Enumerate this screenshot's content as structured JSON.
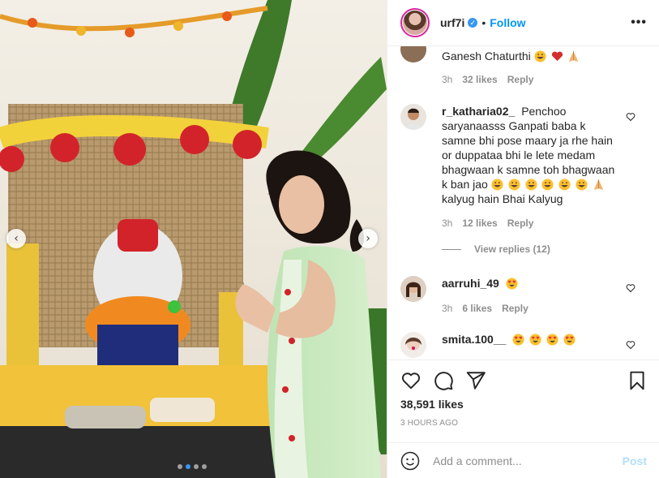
{
  "post": {
    "username": "urf7i",
    "verified_mark": "✓",
    "separator": "•",
    "follow_label": "Follow",
    "more_label": "•••",
    "likes_total": "38,591 likes",
    "timestamp": "3 HOURS AGO",
    "carousel": {
      "dot_count": 4,
      "active_index": 1,
      "prev_glyph": "‹",
      "next_glyph": "›"
    }
  },
  "comments": [
    {
      "username": "",
      "text": "Ganesh Chaturthi",
      "emojis": [
        "grin-emoji",
        "heart-emoji",
        "pray-emoji"
      ],
      "time": "3h",
      "likes": "32 likes",
      "reply": "Reply",
      "partial": true
    },
    {
      "username": "r_katharia02_",
      "text": "Penchoo saryanaasss Ganpati baba k samne bhi pose maary ja rhe hain or duppataa bhi le lete medam bhagwaan k samne toh bhagwaan k ban jao",
      "emojis": [
        "grin-emoji",
        "grin-emoji",
        "grin-emoji",
        "grin-emoji",
        "grin-emoji",
        "grin-emoji",
        "pray-emoji"
      ],
      "tail": "kalyug hain Bhai Kalyug",
      "time": "3h",
      "likes": "12 likes",
      "reply": "Reply",
      "view_replies": "View replies (12)"
    },
    {
      "username": "aarruhi_49",
      "text": "",
      "emojis": [
        "heart-eyes-emoji"
      ],
      "time": "3h",
      "likes": "6 likes",
      "reply": "Reply"
    },
    {
      "username": "smita.100__",
      "text": "",
      "emojis": [
        "heart-eyes-emoji",
        "heart-eyes-emoji",
        "heart-eyes-emoji",
        "heart-eyes-emoji"
      ]
    }
  ],
  "add_comment": {
    "placeholder": "Add a comment...",
    "post_label": "Post"
  },
  "icons": [
    "verified-icon",
    "more-icon",
    "heart-icon",
    "comment-icon",
    "share-icon",
    "bookmark-icon",
    "smiley-icon",
    "chevron-left-icon",
    "chevron-right-icon"
  ],
  "colors": {
    "accent": "#0095f6",
    "post_disabled": "#b2dffc",
    "muted": "#8e8e8e",
    "story_ring": "#d6249f"
  }
}
